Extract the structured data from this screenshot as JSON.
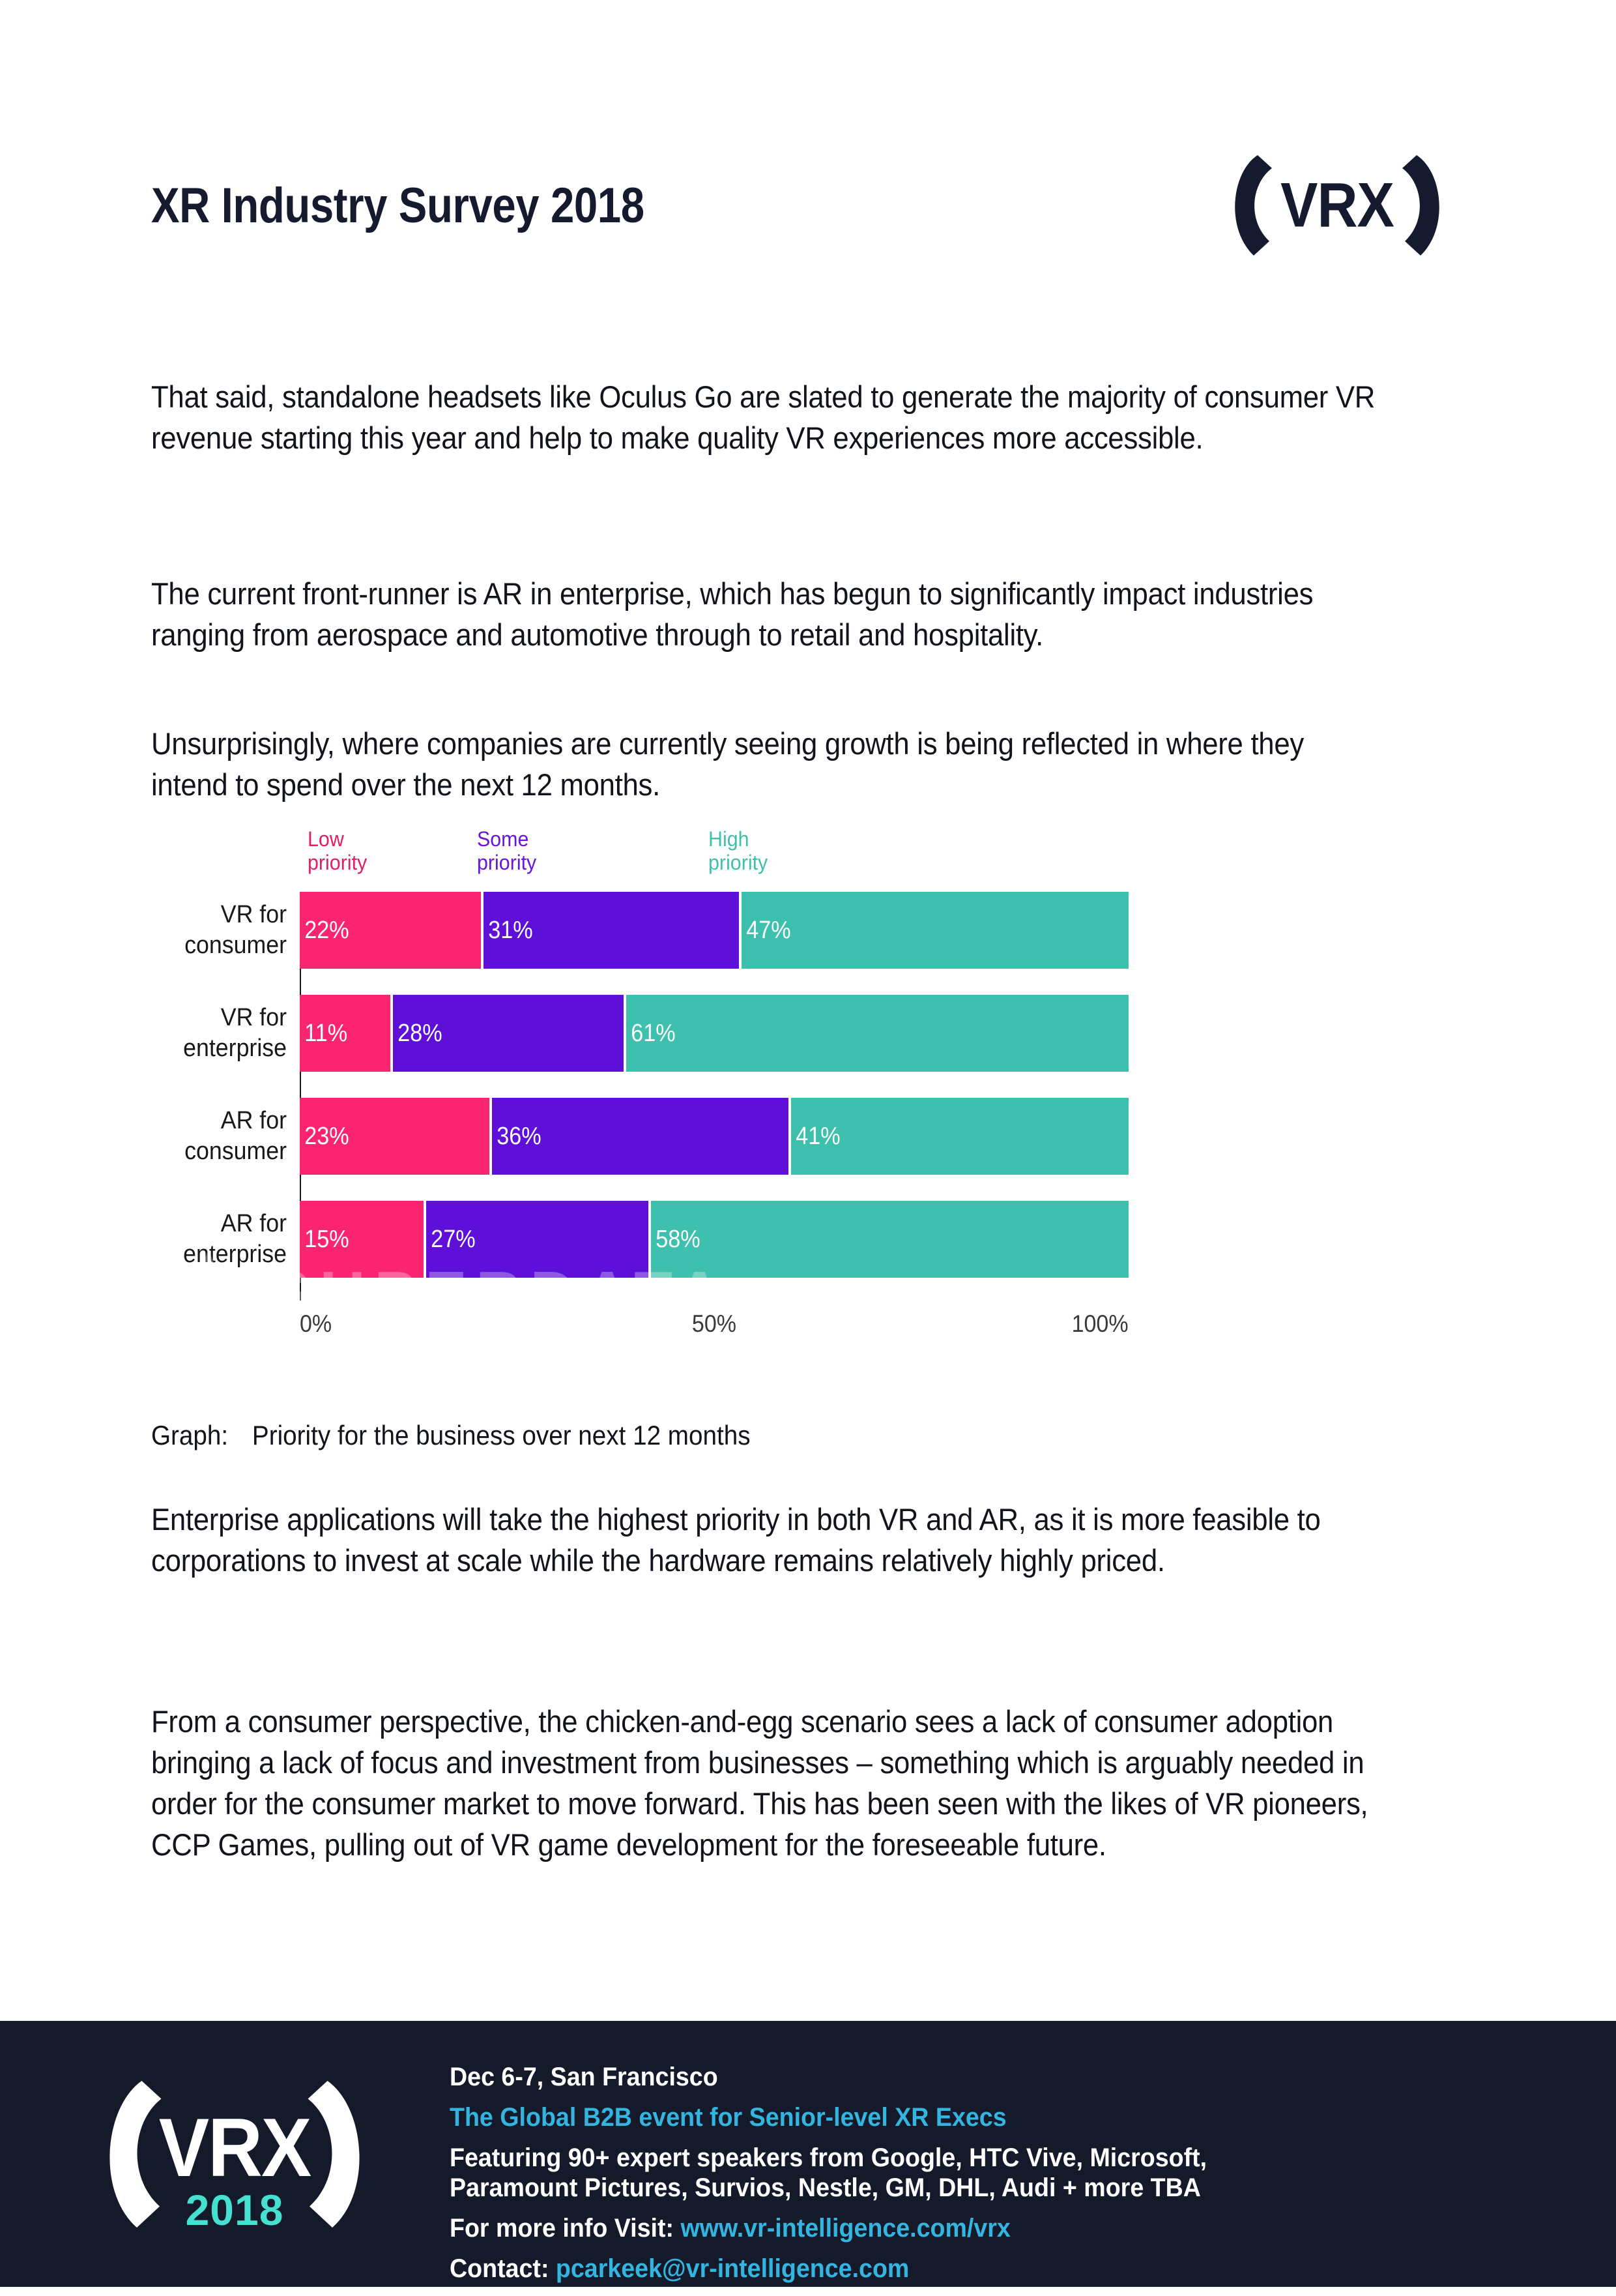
{
  "header": {
    "title": "XR Industry Survey 2018",
    "logo_word": "VRX",
    "logo_name": "vrx-logo"
  },
  "body": {
    "p1": "That said, standalone headsets like Oculus Go are slated to generate the majority of consumer VR revenue starting this year and help to make quality VR experiences more accessible.",
    "p2": "The current front-runner is AR in enterprise, which has begun to significantly impact industries ranging from aerospace and automotive through to retail and hospitality.",
    "p3": "Unsurprisingly, where companies are currently seeing growth is being reflected in where they intend to spend over the next 12 months.",
    "p4": "Enterprise applications will take the highest priority in both VR and AR, as it is more feasible to corporations to invest at scale while the hardware remains relatively highly priced.",
    "p5": "From a consumer perspective, the chicken-and-egg scenario sees a lack of consumer adoption bringing a lack of focus and investment from businesses – something which is arguably needed in order for the consumer market to move forward. This has been seen with the likes of VR pioneers, CCP Games, pulling out of VR game development for the foreseeable future."
  },
  "caption": {
    "key": "Graph:",
    "text": "Priority for the business over next 12 months"
  },
  "watermark": {
    "text": "SUPERDATA"
  },
  "chart_data": {
    "type": "bar",
    "subtype": "stacked-horizontal-100",
    "title": "Priority for the business over next 12 months",
    "xlabel": "",
    "ylabel": "",
    "xlim": [
      0,
      100
    ],
    "grid": false,
    "legend_position": "top",
    "categories": [
      "VR for consumer",
      "VR for enterprise",
      "AR for consumer",
      "AR for enterprise"
    ],
    "category_labels": [
      "VR for\nconsumer",
      "VR for\nenterprise",
      "AR for\nconsumer",
      "AR for\nenterprise"
    ],
    "xticks": [
      "0%",
      "50%",
      "100%"
    ],
    "xtick_values": [
      0,
      50,
      100
    ],
    "series": [
      {
        "name": "Low priority",
        "label": "Low\npriority",
        "color": "#fb2471",
        "values": [
          22,
          11,
          23,
          15
        ],
        "value_labels": [
          "22%",
          "11%",
          "23%",
          "15%"
        ]
      },
      {
        "name": "Some priority",
        "label": "Some\npriority",
        "color": "#5e10d8",
        "values": [
          31,
          28,
          36,
          27
        ],
        "value_labels": [
          "31%",
          "28%",
          "36%",
          "27%"
        ]
      },
      {
        "name": "High priority",
        "label": "High\npriority",
        "color": "#3dc0ad",
        "values": [
          47,
          61,
          41,
          58
        ],
        "value_labels": [
          "47%",
          "61%",
          "41%",
          "58%"
        ]
      }
    ]
  },
  "footer": {
    "logo_word": "VRX",
    "year": "2018",
    "line1": "Dec 6-7, San Francisco",
    "line2": "The Global B2B event for Senior-level XR Execs",
    "line3": "Featuring 90+ expert speakers from Google, HTC Vive, Microsoft,",
    "line4": "Paramount Pictures, Survios, Nestle, GM, DHL, Audi + more TBA",
    "line5_prefix": " For more info Visit: ",
    "line5_link": "www.vr-intelligence.com/vrx",
    "line6_prefix": "Contact: ",
    "line6_link": "pcarkeek@vr-intelligence.com"
  },
  "colors": {
    "low": "#fb2471",
    "some": "#5e10d8",
    "high": "#3dc0ad",
    "navy": "#151a2b",
    "accent_blue": "#34b5e0",
    "accent_teal": "#45e0d0"
  }
}
